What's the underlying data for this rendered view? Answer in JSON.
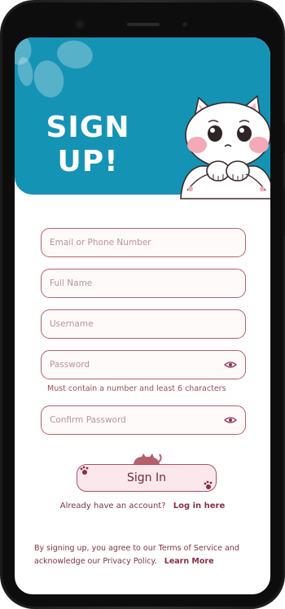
{
  "header": {
    "title_line1": "SIGN",
    "title_line2": "UP!",
    "background_color": "#1593b4"
  },
  "form": {
    "email": {
      "placeholder": "Email or Phone Number"
    },
    "full_name": {
      "placeholder": "Full Name"
    },
    "username": {
      "placeholder": "Username"
    },
    "password": {
      "placeholder": "Password",
      "hint": "Must contain a number and least 6 characters",
      "icon": "eye-icon"
    },
    "confirm_password": {
      "placeholder": "Confirm Password",
      "icon": "eye-icon"
    },
    "border_color": "#b65f6c"
  },
  "actions": {
    "sign_in_label": "Sign In",
    "login_prompt": "Already have an account?",
    "login_link": "Log in here"
  },
  "footer": {
    "terms_text": "By signing up, you agree to our Terms of Service and acknowledge our Privacy Policy.",
    "learn_more": "Learn More"
  },
  "colors": {
    "accent": "#8c2e44",
    "button_fill": "#fbe8ec"
  }
}
